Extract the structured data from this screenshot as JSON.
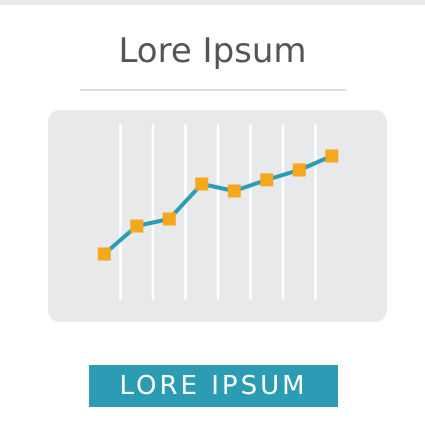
{
  "title": "Lore Ipsum",
  "button": {
    "label": "LORE IPSUM"
  },
  "colors": {
    "line": "#2b9cb3",
    "marker": "#f5a81c",
    "card": "#e8e9ea",
    "gridline": "#ffffff",
    "button_bg": "#2b9cb3"
  },
  "chart_data": {
    "type": "line",
    "x": [
      1,
      2,
      3,
      4,
      5,
      6,
      7,
      8
    ],
    "series": [
      {
        "values": [
          1.0,
          3.0,
          3.5,
          6.0,
          5.5,
          6.3,
          7.0,
          8.0
        ]
      }
    ],
    "xlim": [
      0.5,
      8.5
    ],
    "ylim": [
      0,
      9
    ],
    "grid": "vertical",
    "legend": "none"
  }
}
